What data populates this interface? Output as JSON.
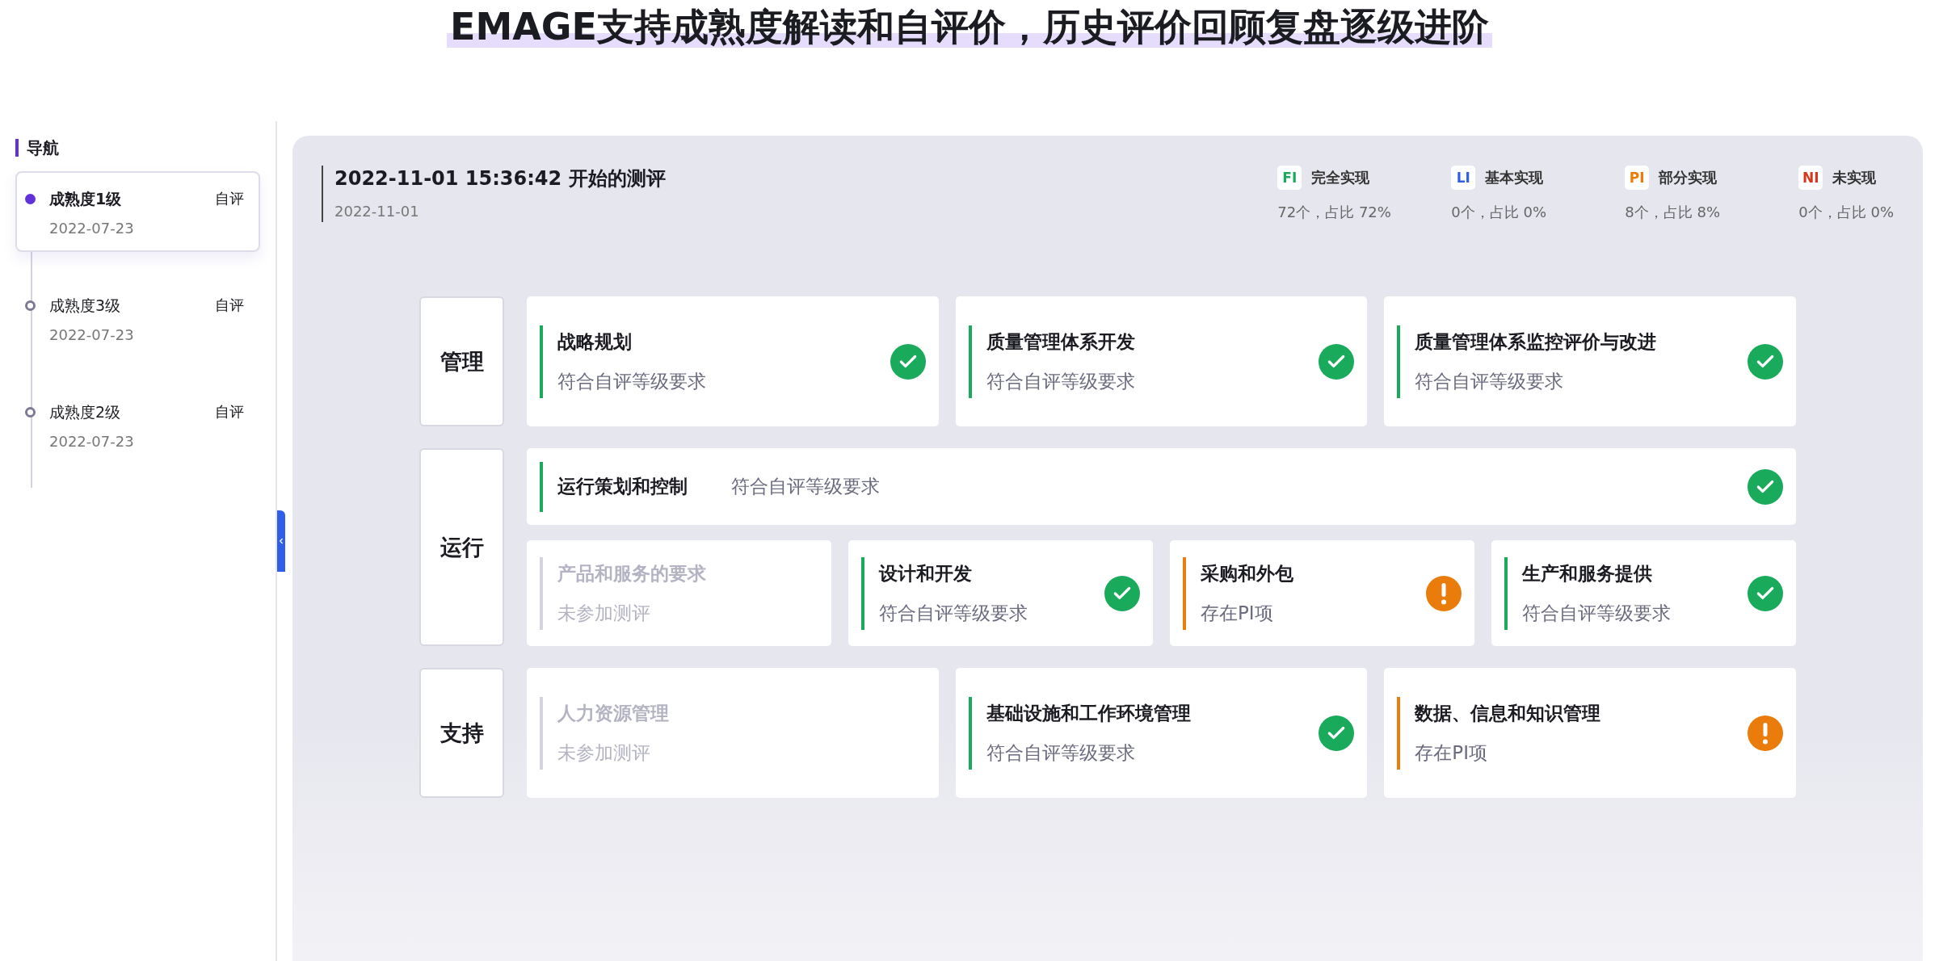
{
  "title": "EMAGE支持成熟度解读和自评价，历史评价回顾复盘逐级进阶",
  "nav": {
    "heading": "导航",
    "items": [
      {
        "name": "成熟度1级",
        "tag": "自评",
        "date": "2022-07-23",
        "selected": true
      },
      {
        "name": "成熟度3级",
        "tag": "自评",
        "date": "2022-07-23",
        "selected": false
      },
      {
        "name": "成熟度2级",
        "tag": "自评",
        "date": "2022-07-23",
        "selected": false
      }
    ]
  },
  "assessment": {
    "title": "2022-11-01 15:36:42 开始的测评",
    "date": "2022-11-01",
    "legend": [
      {
        "code": "FI",
        "label": "完全实现",
        "summary": "72个，占比 72%",
        "color": "#1aaa5b"
      },
      {
        "code": "LI",
        "label": "基本实现",
        "summary": "0个，占比 0%",
        "color": "#2f5ee8"
      },
      {
        "code": "PI",
        "label": "部分实现",
        "summary": "8个，占比 8%",
        "color": "#ea7c0c"
      },
      {
        "code": "NI",
        "label": "未实现",
        "summary": "0个，占比 0%",
        "color": "#d6371e"
      }
    ]
  },
  "groups": [
    {
      "label": "管理",
      "rows": [
        {
          "cards": [
            {
              "kind": "pass",
              "title": "战略规划",
              "status_text": "符合自评等级要求"
            },
            {
              "kind": "pass",
              "title": "质量管理体系开发",
              "status_text": "符合自评等级要求"
            },
            {
              "kind": "pass",
              "title": "质量管理体系监控评价与改进",
              "status_text": "符合自评等级要求"
            }
          ]
        }
      ]
    },
    {
      "label": "运行",
      "rows": [
        {
          "cards": [
            {
              "kind": "pass",
              "title": "运行策划和控制",
              "status_text": "符合自评等级要求"
            }
          ]
        },
        {
          "cards": [
            {
              "kind": "none",
              "title": "产品和服务的要求",
              "status_text": "未参加测评"
            },
            {
              "kind": "pass",
              "title": "设计和开发",
              "status_text": "符合自评等级要求"
            },
            {
              "kind": "pi",
              "title": "采购和外包",
              "status_text": "存在PI项"
            },
            {
              "kind": "pass",
              "title": "生产和服务提供",
              "status_text": "符合自评等级要求"
            }
          ]
        }
      ]
    },
    {
      "label": "支持",
      "rows": [
        {
          "cards": [
            {
              "kind": "none",
              "title": "人力资源管理",
              "status_text": "未参加测评"
            },
            {
              "kind": "pass",
              "title": "基础设施和工作环境管理",
              "status_text": "符合自评等级要求"
            },
            {
              "kind": "pi",
              "title": "数据、信息和知识管理",
              "status_text": "存在PI项"
            }
          ]
        }
      ]
    }
  ]
}
